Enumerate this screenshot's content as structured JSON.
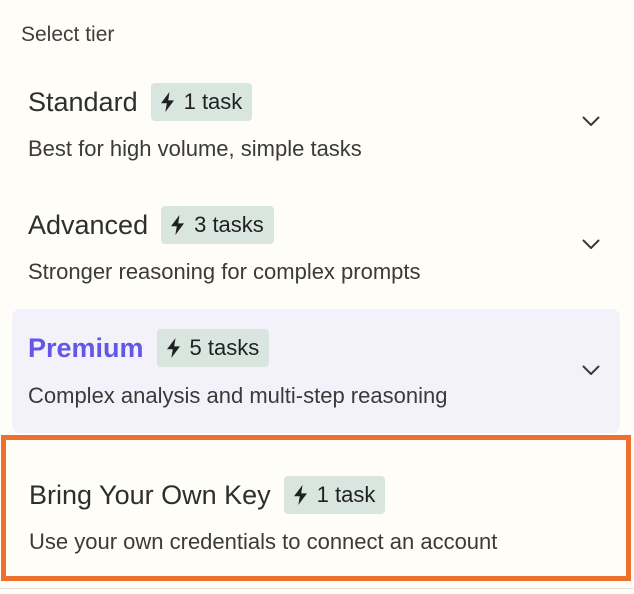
{
  "page": {
    "title": "Select tier"
  },
  "tiers": [
    {
      "name": "Standard",
      "badge": "1 task",
      "description": "Best for high volume, simple tasks",
      "selected": false
    },
    {
      "name": "Advanced",
      "badge": "3 tasks",
      "description": "Stronger reasoning for complex prompts",
      "selected": false
    },
    {
      "name": "Premium",
      "badge": "5 tasks",
      "description": "Complex analysis and multi-step reasoning",
      "selected": true
    }
  ],
  "byok": {
    "name": "Bring Your Own Key",
    "badge": "1 task",
    "description": "Use your own credentials to connect an account"
  },
  "icons": {
    "badge_icon": "lightning-bolt-icon",
    "expand_icon": "chevron-down-icon"
  },
  "colors": {
    "background": "#fffdf8",
    "selected_text": "#6556e6",
    "selected_background": "#f3f2fb",
    "badge_background": "#d9e6e0",
    "highlight_border": "#ef6f2f"
  }
}
